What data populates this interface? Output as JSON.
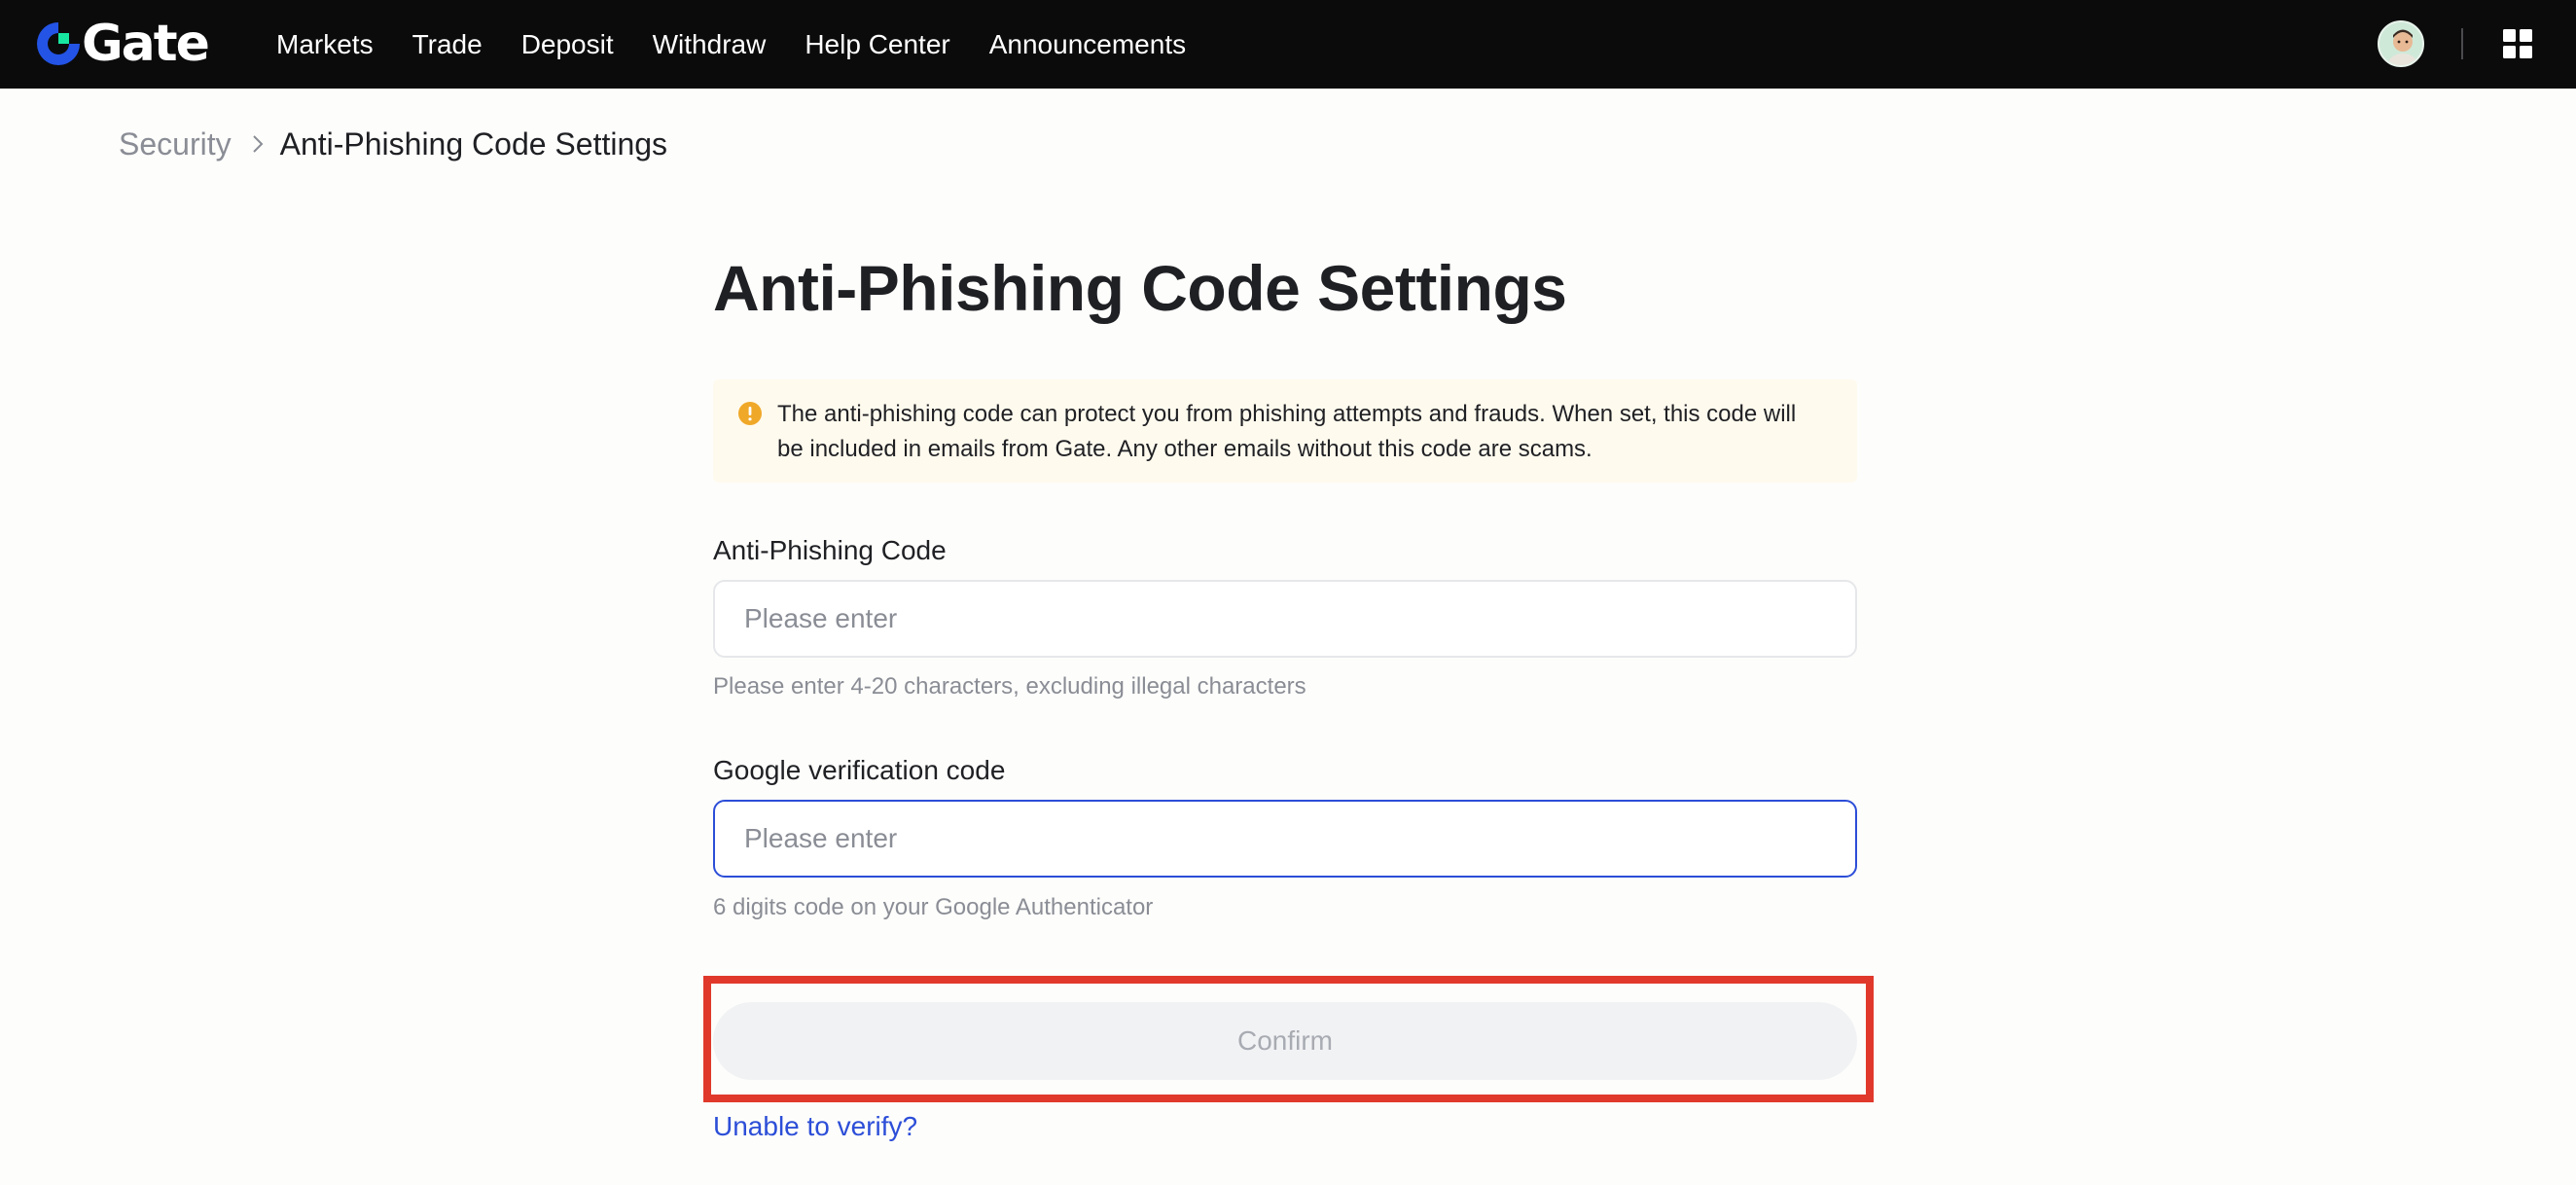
{
  "header": {
    "logo_text": "Gate",
    "nav_items": [
      {
        "label": "Markets"
      },
      {
        "label": "Trade"
      },
      {
        "label": "Deposit"
      },
      {
        "label": "Withdraw"
      },
      {
        "label": "Help Center"
      },
      {
        "label": "Announcements"
      }
    ],
    "icons": {
      "logo": "gate-logo-mark",
      "avatar": "user-avatar",
      "apps": "apps-grid-icon"
    }
  },
  "breadcrumb": {
    "parent": "Security",
    "current": "Anti-Phishing Code Settings"
  },
  "page": {
    "title": "Anti-Phishing Code Settings",
    "notice": "The anti-phishing code can protect you from phishing attempts and frauds. When set, this code will be included in emails from Gate. Any other emails without this code are scams.",
    "fields": {
      "anti_phishing": {
        "label": "Anti-Phishing Code",
        "placeholder": "Please enter",
        "value": "",
        "hint": "Please enter 4-20 characters, excluding illegal characters"
      },
      "google_code": {
        "label": "Google verification code",
        "placeholder": "Please enter",
        "value": "",
        "hint": "6 digits code on your Google Authenticator"
      }
    },
    "confirm_label": "Confirm",
    "help_link": "Unable to verify?"
  },
  "colors": {
    "topbar": "#0b0b0c",
    "brand_blue": "#2c4ed8",
    "brand_green": "#17e6a1",
    "notice_bg": "#fffaee",
    "warning_icon": "#f0a828",
    "highlight": "#e0392b"
  }
}
